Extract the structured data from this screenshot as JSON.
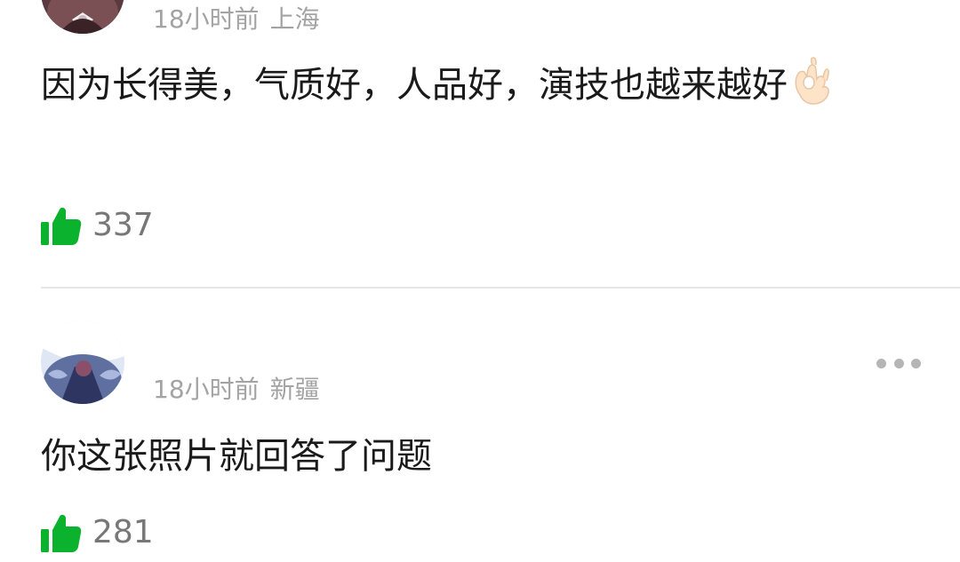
{
  "comments": [
    {
      "time": "18小时前",
      "location": "上海",
      "text": "因为长得美，气质好，人品好，演技也越来越好",
      "emoji": "ok-hand",
      "likes": "337"
    },
    {
      "time": "18小时前",
      "location": "新疆",
      "text": "你这张照片就回答了问题",
      "likes": "281"
    }
  ],
  "colors": {
    "like_green": "#0bb22e",
    "meta_gray": "#a3a3a3",
    "count_gray": "#777777",
    "divider": "#e6e6e6"
  },
  "icons": [
    "avatar",
    "ok-hand-emoji",
    "thumbs-up-icon",
    "more-icon"
  ]
}
